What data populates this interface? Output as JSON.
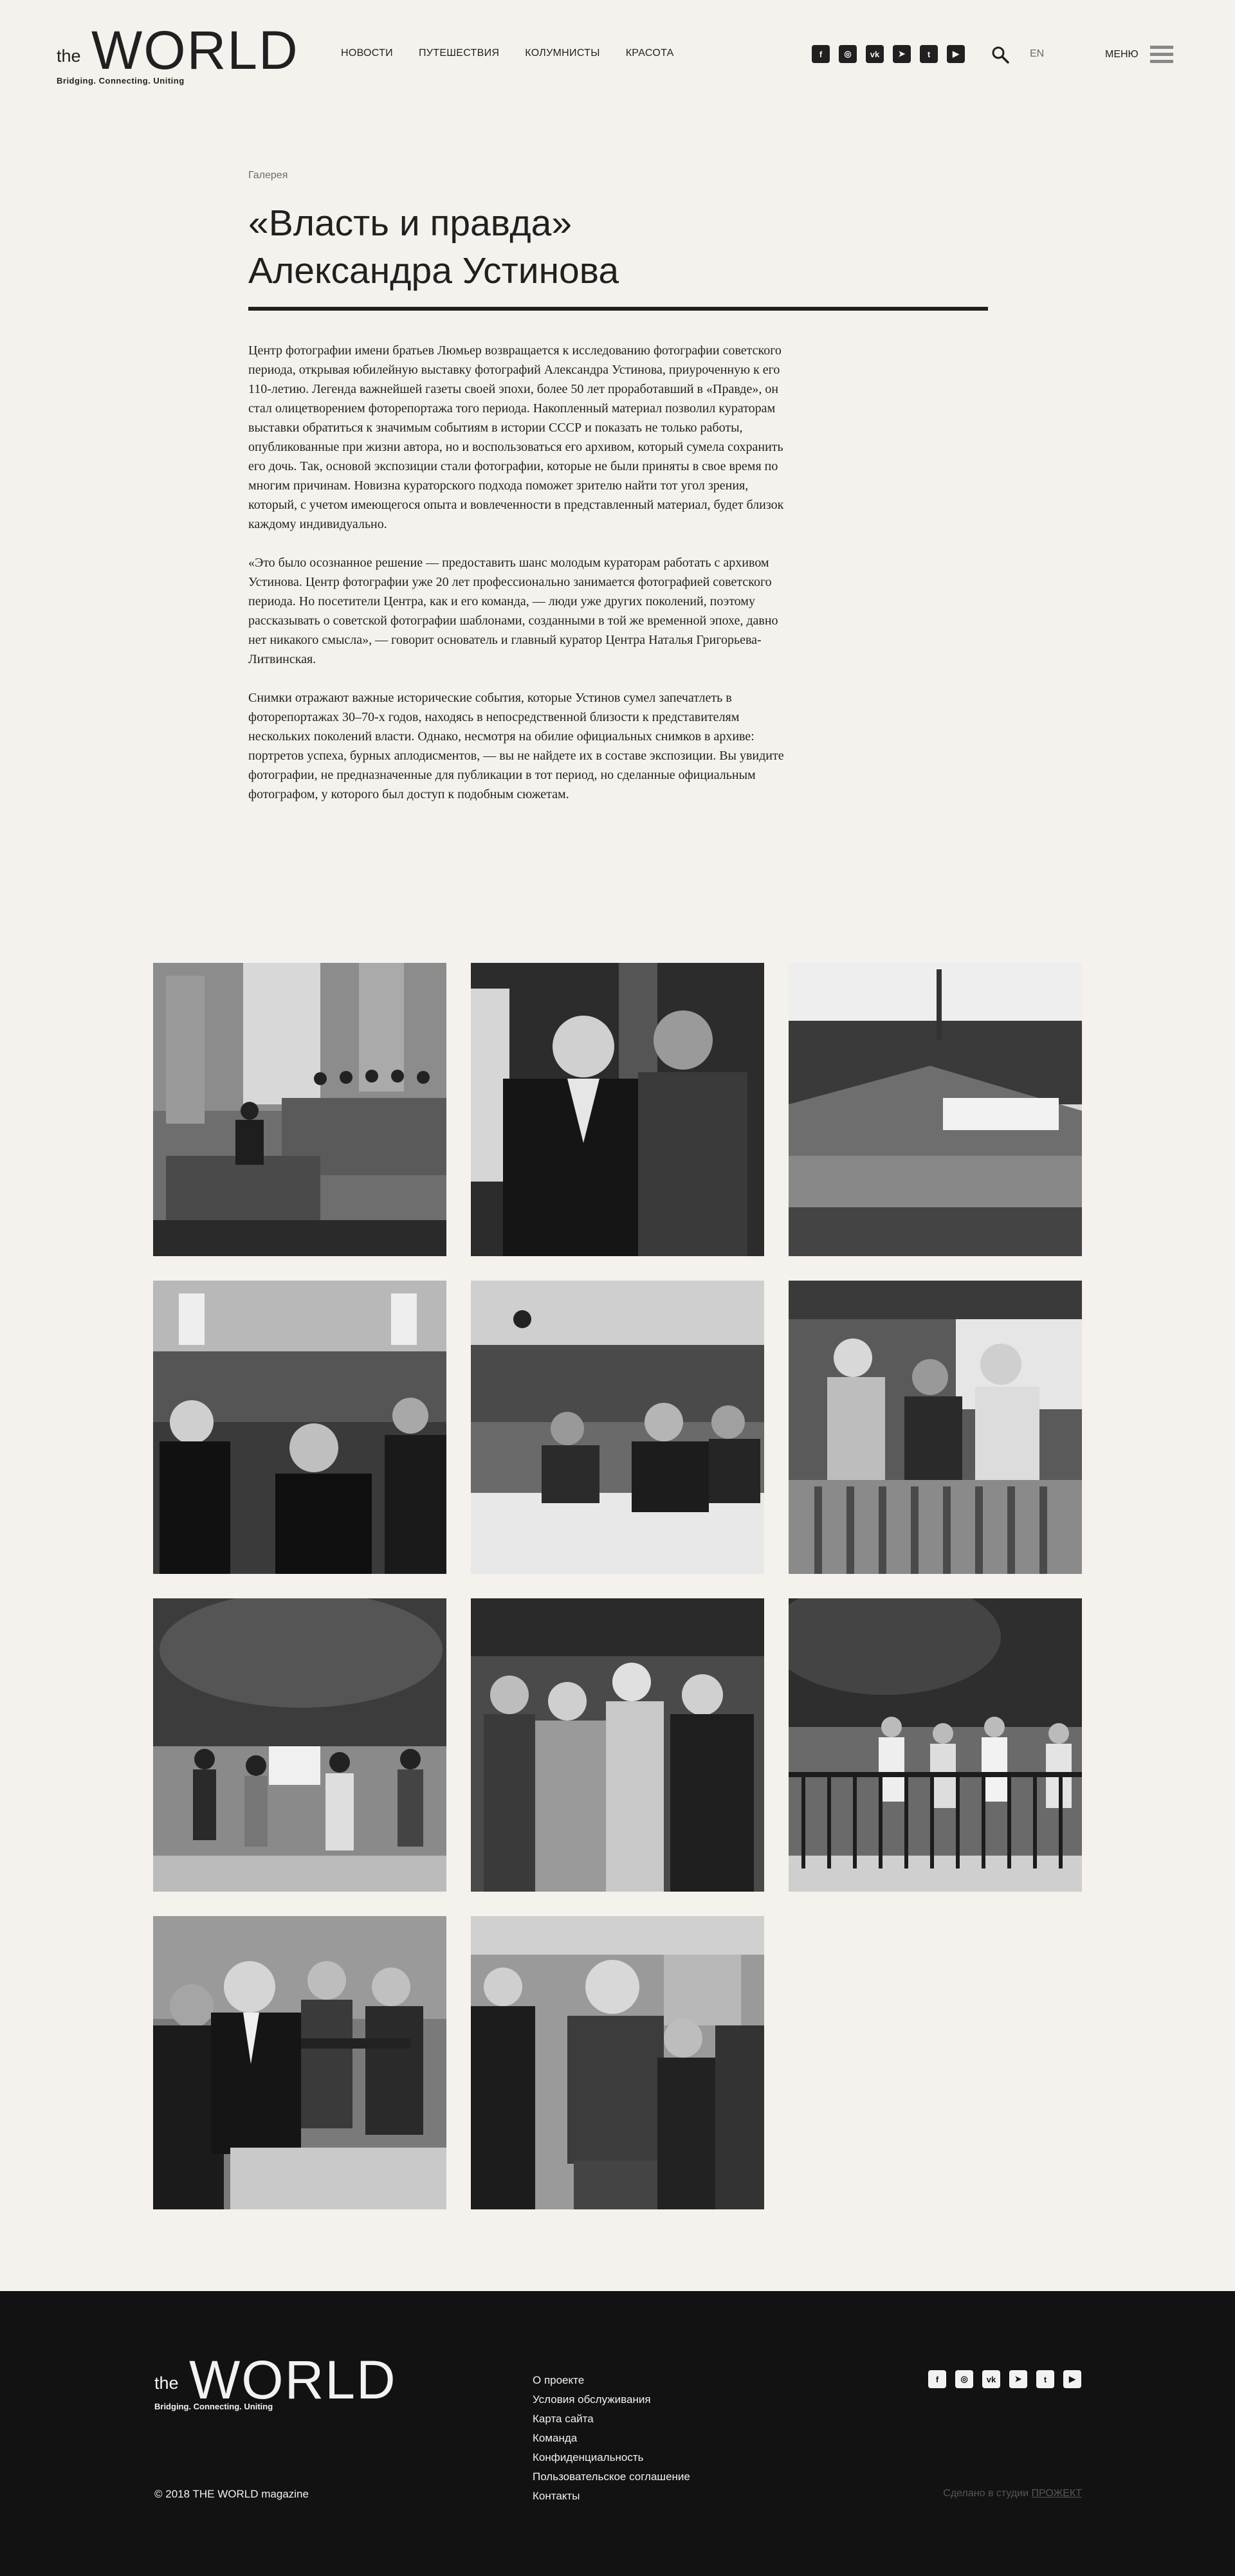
{
  "header": {
    "logo": {
      "the": "the",
      "word": "WORLD",
      "tagline": "Bridging. Connecting. Uniting"
    },
    "nav": [
      "Новости",
      "Путешествия",
      "Колумнисты",
      "Красота"
    ],
    "social": [
      {
        "icon": "facebook-icon",
        "glyph": "f"
      },
      {
        "icon": "instagram-icon",
        "glyph": "◎"
      },
      {
        "icon": "vk-icon",
        "glyph": "vk"
      },
      {
        "icon": "telegram-icon",
        "glyph": "➤"
      },
      {
        "icon": "twitter-icon",
        "glyph": "t"
      },
      {
        "icon": "youtube-icon",
        "glyph": "▶"
      }
    ],
    "lang": "EN",
    "menu_label": "Меню"
  },
  "article": {
    "rubric": "Галерея",
    "title_line1": "«Власть и правда»",
    "title_line2": "Александра Устинова",
    "paragraphs": [
      "Центр фотографии имени братьев Люмьер возвращается к исследованию фотографии советского периода, открывая юбилейную выставку фотографий Александра Устинова, приуроченную к его 110-летию. Легенда важнейшей газеты своей эпохи, более 50 лет проработавший в «Правде», он стал олицетворением фоторепортажа того периода. Накопленный материал позволил кураторам выставки обратиться к значимым событиям в истории СССР и показать не только работы, опубликованные при жизни автора, но и воспользоваться его архивом, который сумела сохранить его дочь. Так, основой экспозиции стали фотографии, которые не были приняты в свое время по многим причинам. Новизна кураторского подхода поможет зрителю найти тот угол зрения, который, с учетом имеющегося опыта и вовлеченности в представленный материал, будет близок каждому индивидуально.",
      "«Это было осознанное решение — предоставить шанс молодым кураторам работать с архивом Устинова. Центр фотографии уже 20 лет профессионально занимается фотографией советского периода. Но посетители Центра, как и его команда, — люди уже других поколений, поэтому рассказывать о советской фотографии шаблонами, созданными в той же временной эпохе, давно нет никакого смысла», — говорит основатель и главный куратор Центра Наталья Григорьева-Литвинская.",
      "Снимки отражают важные исторические события, которые Устинов сумел запечатлеть в фоторепортажах 30–70-х годов, находясь в непосредственной близости к представителям нескольких поколений власти. Однако, несмотря на обилие официальных снимков в архиве: портретов успеха, бурных аплодисментов, — вы не найдете их в составе экспозиции. Вы увидите фотографии, не предназначенные для публикации в тот период, но сделанные официальным фотографом, у которого был доступ к подобным сюжетам."
    ]
  },
  "gallery": [
    {
      "scene": "speaker-at-podium"
    },
    {
      "scene": "two-men-talking"
    },
    {
      "scene": "crowd-on-roof"
    },
    {
      "scene": "audience-hall"
    },
    {
      "scene": "motorcade-crowd"
    },
    {
      "scene": "balcony-group"
    },
    {
      "scene": "women-with-banner"
    },
    {
      "scene": "group-with-women"
    },
    {
      "scene": "people-behind-fence"
    },
    {
      "scene": "men-pointing"
    },
    {
      "scene": "men-embracing"
    }
  ],
  "footer": {
    "logo": {
      "the": "the",
      "word": "WORLD",
      "tagline": "Bridging. Connecting. Uniting"
    },
    "links": [
      "О проекте",
      "Условия обслуживания",
      "Карта сайта",
      "Команда",
      "Конфиденциальность",
      "Пользовательское соглашение",
      "Контакты"
    ],
    "copyright": "© 2018 THE WORLD magazine",
    "studio_text": "Сделано в студии",
    "studio_link": "ПРОЖЕКТ"
  }
}
